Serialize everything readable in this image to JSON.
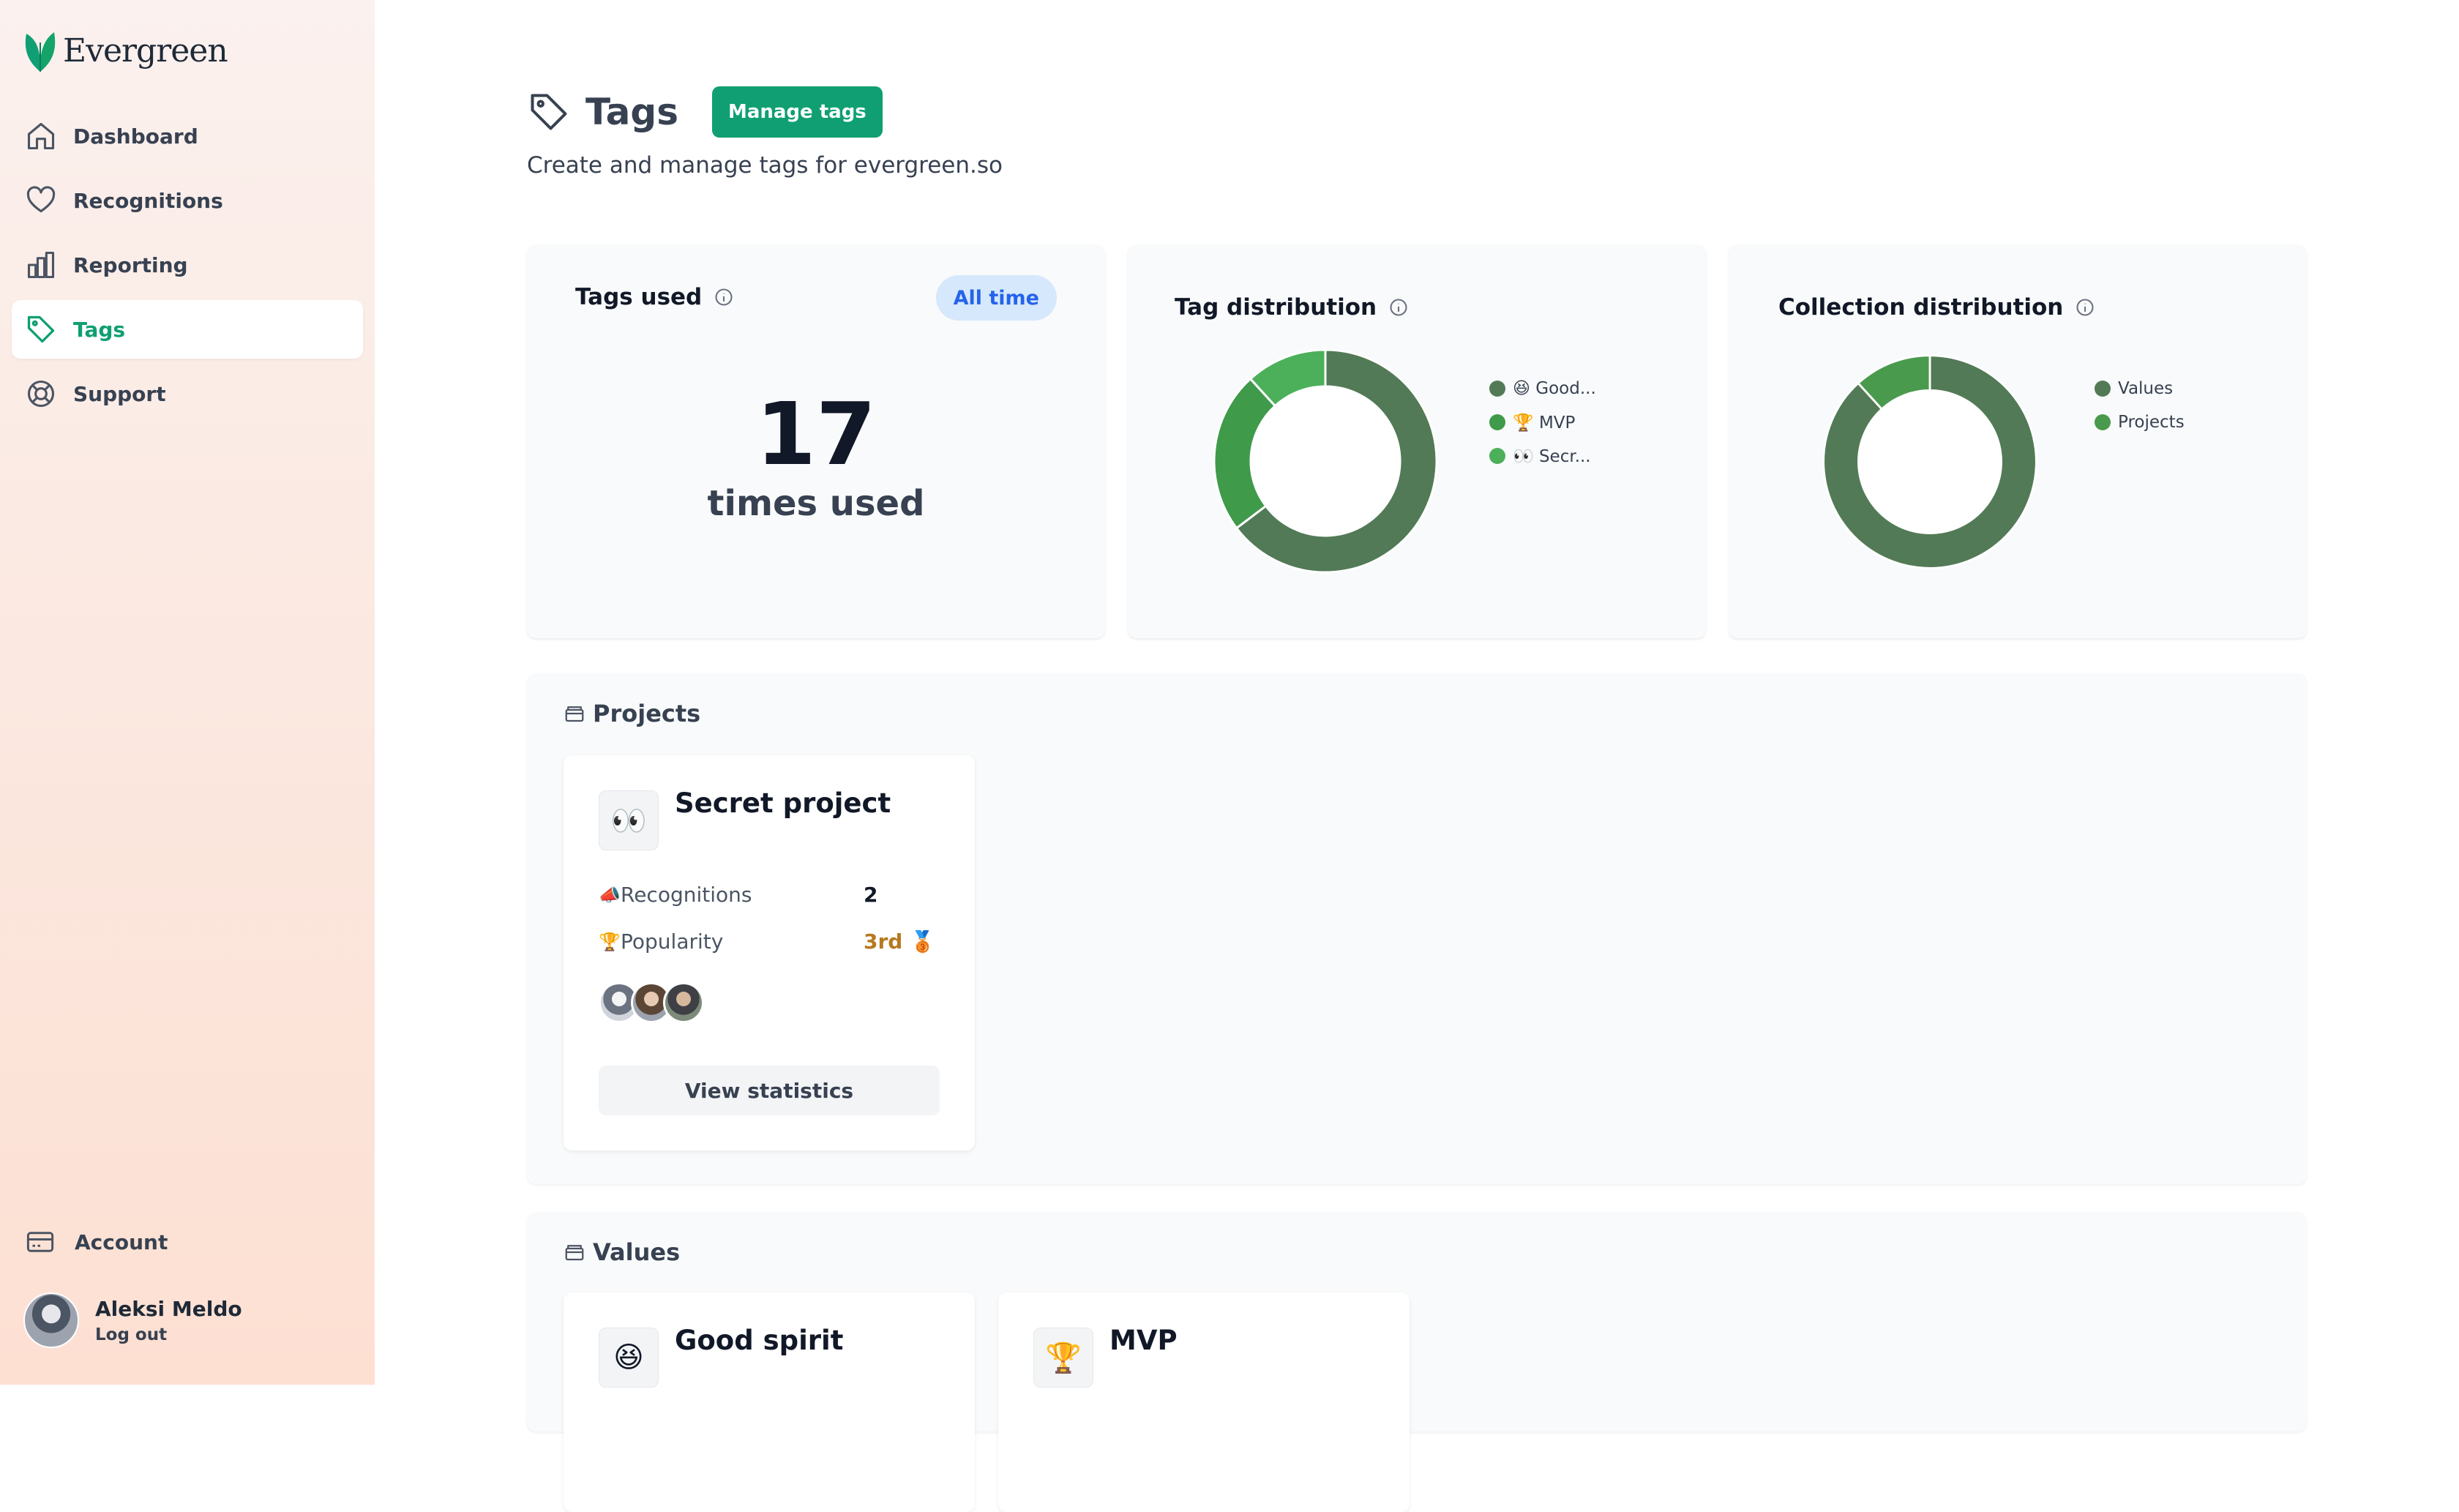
{
  "brand": {
    "name": "Evergreen"
  },
  "sidebar": {
    "items": [
      {
        "label": "Dashboard",
        "icon": "home-icon"
      },
      {
        "label": "Recognitions",
        "icon": "heart-icon"
      },
      {
        "label": "Reporting",
        "icon": "bar-chart-icon"
      },
      {
        "label": "Tags",
        "icon": "tag-icon",
        "active": true
      },
      {
        "label": "Support",
        "icon": "lifebuoy-icon"
      }
    ],
    "account_label": "Account",
    "user": {
      "name": "Aleksi Meldo",
      "logout": "Log out"
    }
  },
  "header": {
    "title": "Tags",
    "manage_button": "Manage tags",
    "subtitle": "Create and manage tags for evergreen.so"
  },
  "cards": {
    "tags_used": {
      "title": "Tags used",
      "filter": "All time",
      "count": "17",
      "count_label": "times used"
    },
    "tag_distribution": {
      "title": "Tag distribution"
    },
    "collection_distribution": {
      "title": "Collection distribution"
    }
  },
  "chart_data": [
    {
      "type": "pie",
      "title": "Tag distribution",
      "categories": [
        "😆 Good...",
        "🏆 MVP",
        "👀 Secr..."
      ],
      "values": [
        11,
        4,
        2
      ],
      "colors": [
        "#527a56",
        "#3f9a4a",
        "#4cb05a"
      ]
    },
    {
      "type": "pie",
      "title": "Collection distribution",
      "categories": [
        "Values",
        "Projects"
      ],
      "values": [
        15,
        2
      ],
      "colors": [
        "#527a56",
        "#4a9a4e"
      ]
    }
  ],
  "projects": {
    "title": "Projects",
    "items": [
      {
        "emoji": "👀",
        "name": "Secret project",
        "recognitions_label": "Recognitions",
        "recognitions_icon": "📣",
        "recognitions": "2",
        "popularity_label": "Popularity",
        "popularity_icon": "🏆",
        "popularity": "3rd 🥉",
        "button": "View statistics"
      }
    ]
  },
  "values": {
    "title": "Values",
    "items": [
      {
        "emoji": "😆",
        "name": "Good spirit"
      },
      {
        "emoji": "🏆",
        "name": "MVP"
      }
    ]
  },
  "colors": {
    "accent": "#0f9f73",
    "pill_bg": "#d6e8fb",
    "pill_text": "#2563eb",
    "bronze": "#b7791f"
  }
}
